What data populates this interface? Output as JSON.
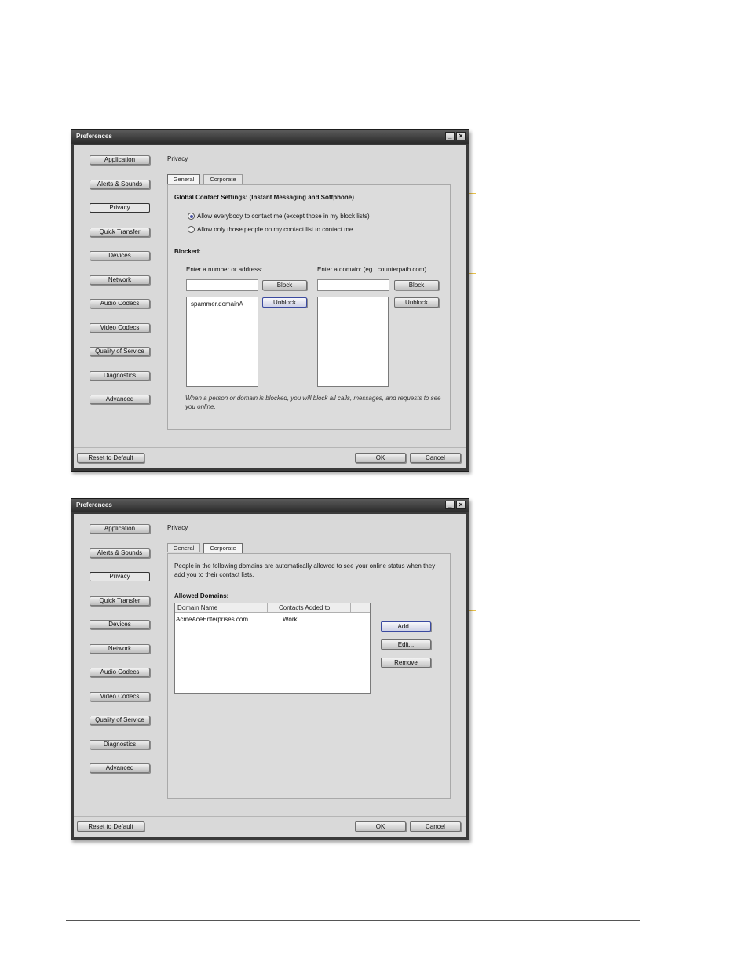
{
  "page": {},
  "dialog_general": {
    "window_title": "Preferences",
    "nav": [
      "Application",
      "Alerts & Sounds",
      "Privacy",
      "Quick Transfer",
      "Devices",
      "Network",
      "Audio Codecs",
      "Video Codecs",
      "Quality of Service",
      "Diagnostics",
      "Advanced"
    ],
    "active_nav": "Privacy",
    "section_title": "Privacy",
    "tabs": [
      "General",
      "Corporate"
    ],
    "selected_tab": "General",
    "global_heading": "Global Contact Settings: (Instant Messaging and Softphone)",
    "radio_allow_everybody": "Allow everybody to contact me (except those in my block lists)",
    "radio_allow_contacts_only": "Allow only those people on my contact list to contact me",
    "radio_selected": "allow-everybody",
    "blocked_heading": "Blocked:",
    "number_label": "Enter a number or address:",
    "number_value": "",
    "domain_label": "Enter a domain: (eg., counterpath.com)",
    "domain_value": "",
    "block_label": "Block",
    "unblock_label": "Unblock",
    "blocked_numbers": [
      "spammer.domainA"
    ],
    "blocked_domains": [],
    "note": "When a person or domain is blocked, you will block all calls, messages, and requests to see you online.",
    "reset_label": "Reset to Default",
    "ok_label": "OK",
    "cancel_label": "Cancel"
  },
  "dialog_corporate": {
    "window_title": "Preferences",
    "nav": [
      "Application",
      "Alerts & Sounds",
      "Privacy",
      "Quick Transfer",
      "Devices",
      "Network",
      "Audio Codecs",
      "Video Codecs",
      "Quality of Service",
      "Diagnostics",
      "Advanced"
    ],
    "active_nav": "Privacy",
    "section_title": "Privacy",
    "tabs": [
      "General",
      "Corporate"
    ],
    "selected_tab": "Corporate",
    "intro": "People in the following domains are automatically allowed to see your online status when they add you to their contact lists.",
    "allowed_heading": "Allowed Domains:",
    "columns": [
      "Domain Name",
      "Contacts Added to"
    ],
    "rows": [
      [
        "AcmeAceEnterprises.com",
        "Work"
      ]
    ],
    "add_label": "Add...",
    "edit_label": "Edit...",
    "remove_label": "Remove",
    "reset_label": "Reset to Default",
    "ok_label": "OK",
    "cancel_label": "Cancel"
  },
  "colors": {
    "callout": "#e8c14a",
    "window_frame": "#3a3a3a",
    "client_bg": "#d9d9d9",
    "radio_selected": "#4b56a8"
  }
}
